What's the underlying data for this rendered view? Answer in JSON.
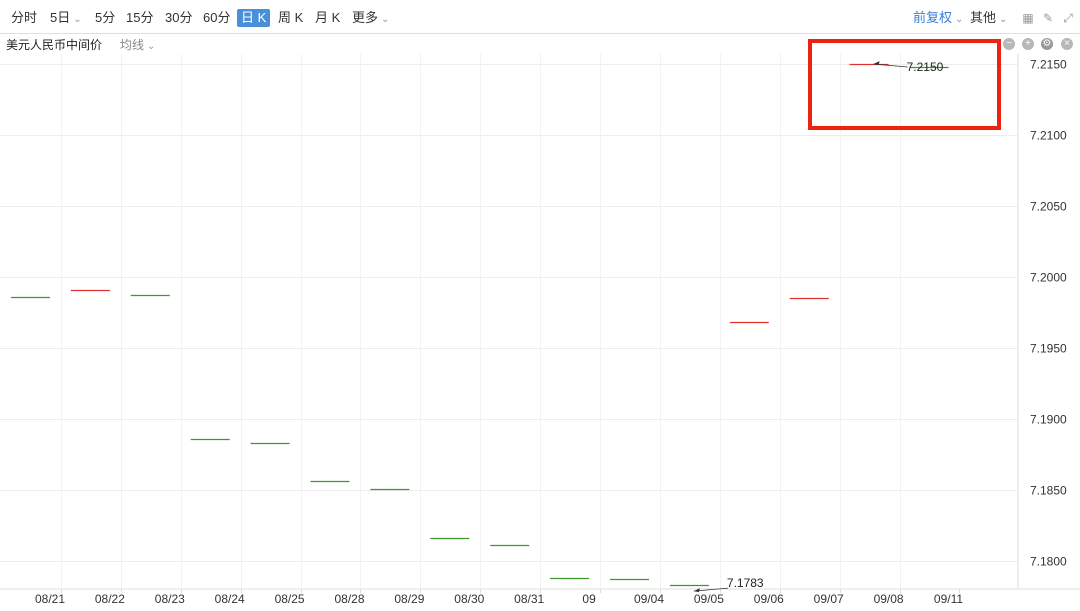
{
  "toolbar": {
    "periods": [
      {
        "label": "分时",
        "active": false
      },
      {
        "label": "5日",
        "active": false,
        "dropdown": true
      },
      {
        "label": "5分",
        "active": false
      },
      {
        "label": "15分",
        "active": false
      },
      {
        "label": "30分",
        "active": false
      },
      {
        "label": "60分",
        "active": false
      },
      {
        "label": "日 K",
        "active": true
      },
      {
        "label": "周 K",
        "active": false
      },
      {
        "label": "月 K",
        "active": false
      },
      {
        "label": "更多",
        "active": false,
        "dropdown": true
      }
    ],
    "adjust_label": "前复权",
    "other_label": "其他",
    "icons": [
      "grid-icon",
      "pencil-icon",
      "fullscreen-icon"
    ]
  },
  "chart_header": {
    "title": "美元人民币中间价",
    "ma_label": "均线",
    "icons": [
      "minus-circle-icon",
      "plus-circle-icon",
      "gear-icon",
      "close-circle-icon"
    ]
  },
  "colors": {
    "up": "#e03030",
    "down": "#3a9a2a",
    "grid": "#ececec",
    "accent": "#4a90d9",
    "highlight": "#ee2211"
  },
  "chart_data": {
    "type": "candlestick",
    "title": "美元人民币中间价",
    "categories": [
      "08/21",
      "08/22",
      "08/23",
      "08/24",
      "08/25",
      "08/28",
      "08/29",
      "08/30",
      "08/31",
      "09",
      "09/04",
      "09/05",
      "09/06",
      "09/07",
      "09/08",
      "09/11"
    ],
    "values": [
      7.1986,
      7.1991,
      7.1987,
      7.1886,
      7.1883,
      7.1856,
      7.1851,
      7.1816,
      7.1811,
      7.1788,
      7.1787,
      7.1783,
      7.1968,
      7.1985,
      7.215,
      7.2148
    ],
    "direction": [
      "down",
      "up",
      "down",
      "down",
      "down",
      "down",
      "down",
      "down",
      "down",
      "down",
      "down",
      "down",
      "up",
      "up",
      "up",
      "down"
    ],
    "yticks": [
      "7.2150",
      "7.2100",
      "7.2050",
      "7.2000",
      "7.1950",
      "7.1900",
      "7.1850",
      "7.1800"
    ],
    "ylim": [
      7.1785,
      7.2155
    ],
    "annotations": [
      {
        "text": "7.2150",
        "index": 14
      },
      {
        "text": "7.1783",
        "index": 11
      }
    ],
    "grid": true
  }
}
